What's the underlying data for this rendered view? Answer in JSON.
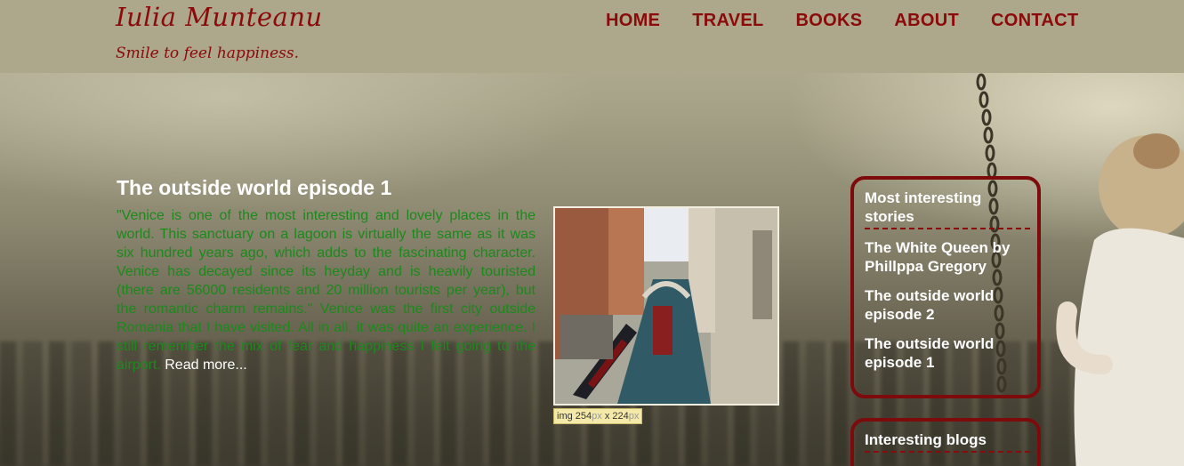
{
  "site": {
    "title": "Iulia Munteanu",
    "tagline": "Smile to feel happiness."
  },
  "nav": [
    {
      "label": "HOME"
    },
    {
      "label": "TRAVEL"
    },
    {
      "label": "BOOKS"
    },
    {
      "label": "ABOUT"
    },
    {
      "label": "CONTACT"
    }
  ],
  "article": {
    "title": "The outside world episode 1",
    "body": "\"Venice is one of the most interesting and lovely places in the world. This sanctuary on a lagoon is virtually the same as it was six hundred years ago, which adds to the fascinating character. Venice has decayed since its heyday and is heavily touristed (there are 56000 residents and 20 million tourists per year), but the romantic charm remains.\" Venice was the first city outside Romania that I have visited. All in all, it was quite an experience. I still remember the mix of fear and happiness I felt going to the airport.",
    "read_more": "Read more..."
  },
  "image_tooltip": {
    "tag": "img",
    "width": "254",
    "height": "224",
    "unit": "px",
    "sep": "x"
  },
  "sidebar": {
    "stories": {
      "heading": "Most interesting stories",
      "links": [
        {
          "label": "The White Queen by Phillppa Gregory"
        },
        {
          "label": "The outside world episode 2"
        },
        {
          "label": "The outside world episode 1"
        }
      ]
    },
    "blogs": {
      "heading": "Interesting blogs"
    }
  },
  "colors": {
    "brand": "#8b0a0a",
    "header_bg": "#ada78b",
    "article_text": "#1b8a1b"
  }
}
